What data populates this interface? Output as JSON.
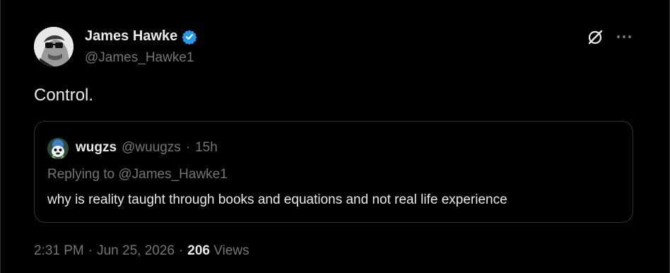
{
  "author": {
    "name": "James Hawke",
    "handle": "@James_Hawke1",
    "verified_color": "#1d9bf0"
  },
  "tweet": {
    "text": "Control."
  },
  "icons": {
    "top_right": [
      "grok-icon",
      "more-icon"
    ]
  },
  "quote": {
    "name": "wugzs",
    "handle": "@wuugzs",
    "separator": "·",
    "time": "15h",
    "replying_prefix": "Replying to",
    "replying_to": "@James_Hawke1",
    "text": "why is reality taught through books and equations and not real life experience"
  },
  "footer": {
    "time": "2:31 PM",
    "separator1": "·",
    "date": "Jun 25, 2026",
    "separator2": "·",
    "views_count": "206",
    "views_label": "Views"
  },
  "colors": {
    "background": "#000000",
    "primary_text": "#e7e9ea",
    "secondary_text": "#71767b",
    "border": "#2f3336"
  }
}
